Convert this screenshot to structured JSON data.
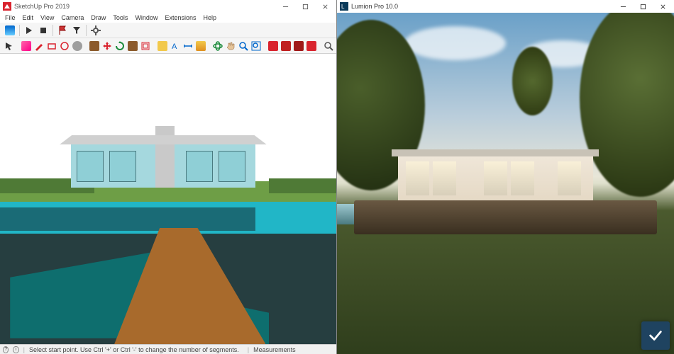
{
  "left": {
    "title": "SketchUp Pro 2019",
    "menu": [
      "File",
      "Edit",
      "View",
      "Camera",
      "Draw",
      "Tools",
      "Window",
      "Extensions",
      "Help"
    ],
    "toolbar1_names": [
      "styles-icon",
      "play-icon",
      "stop-icon",
      "flag-icon",
      "filter-icon",
      "settings-icon"
    ],
    "toolbar2_names": [
      "select-icon",
      "eraser-icon",
      "pencil-icon",
      "rectangle-icon",
      "circle-icon",
      "color-icon",
      "pushpull-icon",
      "move-icon",
      "rotate-icon",
      "scale-icon",
      "offset-icon",
      "tape-icon",
      "text-icon",
      "dimension-icon",
      "paint-icon",
      "orbit-icon",
      "pan-icon",
      "zoom-icon",
      "zoom-extents-icon",
      "layer1-icon",
      "layer2-icon",
      "layer3-icon",
      "layer4-icon",
      "search-icon"
    ],
    "status": {
      "hint": "Select start point. Use Ctrl '+' or Ctrl '-' to change the number of segments.",
      "meas_label": "Measurements"
    }
  },
  "right": {
    "title": "Lumion Pro 10.0"
  }
}
